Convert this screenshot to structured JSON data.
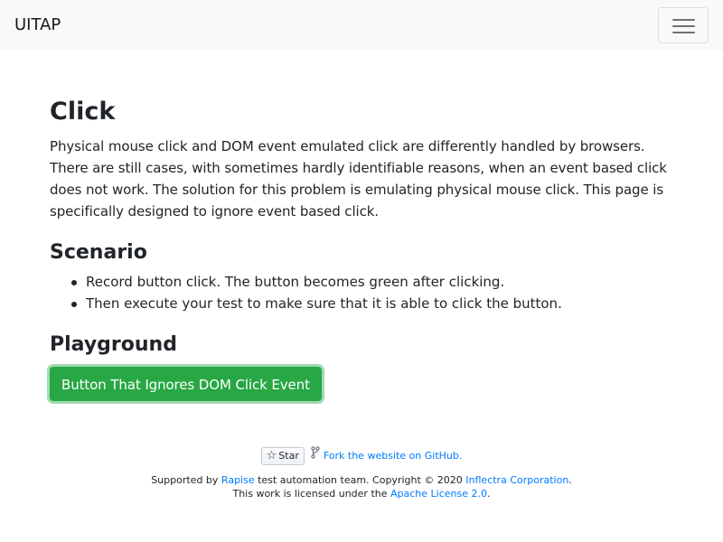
{
  "navbar": {
    "brand": "UITAP",
    "toggler_icon": "hamburger-menu-icon"
  },
  "main": {
    "title": "Click",
    "description": "Physical mouse click and DOM event emulated click are differently handled by browsers. There are still cases, with sometimes hardly identifiable reasons, when an event based click does not work. The solution for this problem is emulating physical mouse click. This page is specifically designed to ignore event based click.",
    "scenario_heading": "Scenario",
    "scenario_items": [
      "Record button click. The button becomes green after clicking.",
      "Then execute your test to make sure that it is able to click the button."
    ],
    "playground_heading": "Playground",
    "button_label": "Button That Ignores DOM Click Event",
    "button_color": "#28a745"
  },
  "footer": {
    "star_label": "Star",
    "star_icon": "star-icon",
    "fork_icon": "repo-fork-icon",
    "fork_link": "Fork the website on GitHub.",
    "supported_prefix": "Supported by ",
    "rapise_link": "Rapise",
    "supported_middle": " test automation team. Copyright © 2020 ",
    "inflectra_link": "Inflectra Corporation",
    "supported_suffix": ".",
    "license_prefix": "This work is licensed under the ",
    "license_link": "Apache License 2.0",
    "license_suffix": ".",
    "link_color": "#007bff"
  }
}
